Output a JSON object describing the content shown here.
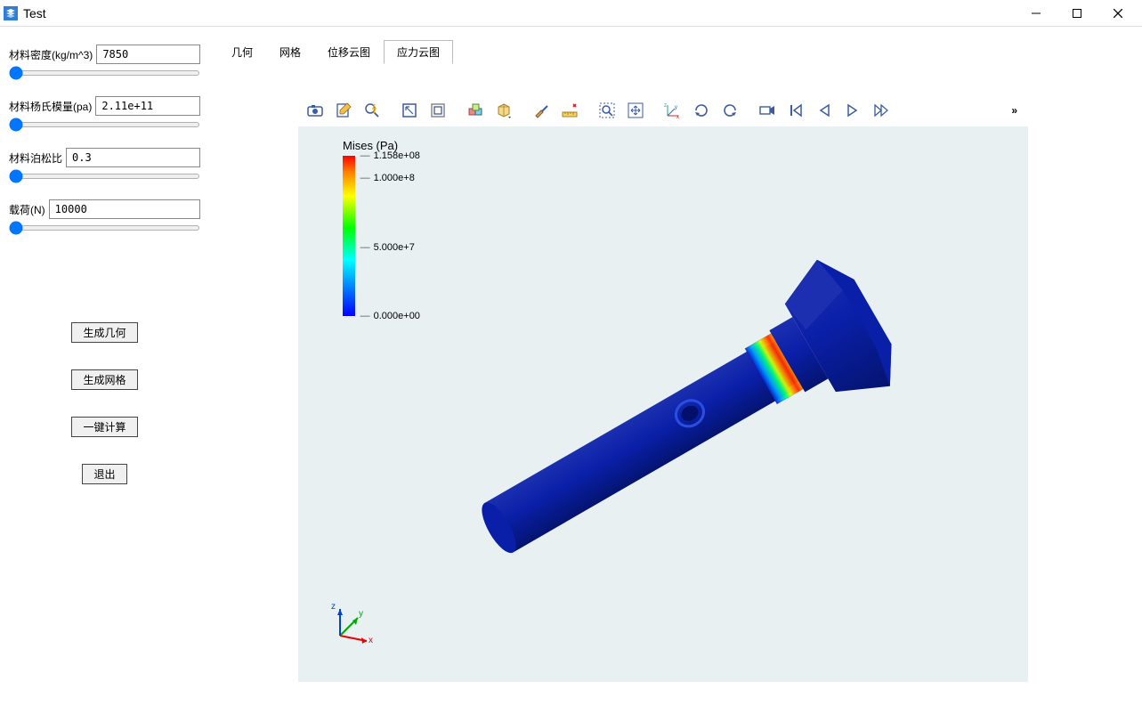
{
  "window": {
    "title": "Test"
  },
  "sidebar": {
    "params": [
      {
        "label": "材料密度(kg/m^3)",
        "value": "7850"
      },
      {
        "label": "材料杨氏模量(pa)",
        "value": "2.11e+11"
      },
      {
        "label": "材料泊松比",
        "value": "0.3"
      },
      {
        "label": "载荷(N)",
        "value": "10000"
      }
    ],
    "buttons": {
      "generate_geometry": "生成几何",
      "generate_mesh": "生成网格",
      "one_click_calc": "一键计算",
      "exit": "退出"
    }
  },
  "tabs": {
    "items": [
      "几何",
      "网格",
      "位移云图",
      "应力云图"
    ],
    "active_index": 3
  },
  "toolbar": {
    "icons": [
      "camera-icon",
      "write-icon",
      "search-bolt-icon",
      "select-box-icon",
      "box-outline-icon",
      "cubes-icon",
      "cube-dropdown-icon",
      "brush-icon",
      "ruler-cross-icon",
      "zoom-area-icon",
      "pan-icon",
      "axes-icon",
      "rotate-cw-icon",
      "rotate-ccw-icon",
      "video-icon",
      "first-frame-icon",
      "play-back-icon",
      "play-icon",
      "fast-forward-icon"
    ],
    "more": "»"
  },
  "legend": {
    "title": "Mises (Pa)",
    "labels": [
      {
        "pos": 0,
        "text": "1.158e+08"
      },
      {
        "pos": 14,
        "text": "1.000e+8"
      },
      {
        "pos": 57,
        "text": "5.000e+7"
      },
      {
        "pos": 100,
        "text": "0.000e+00"
      }
    ]
  },
  "triad": {
    "x": "x",
    "y": "y",
    "z": "z"
  }
}
